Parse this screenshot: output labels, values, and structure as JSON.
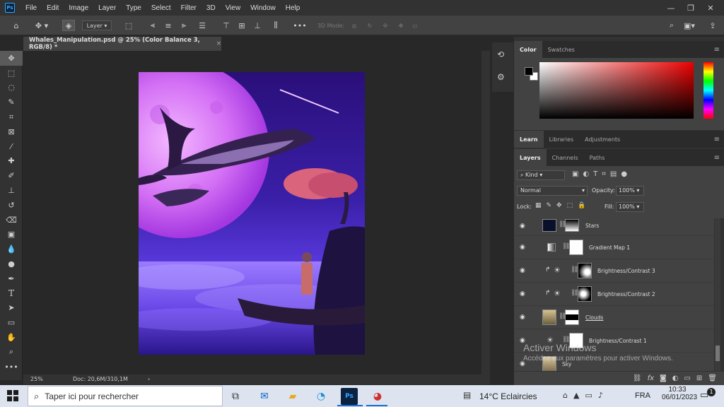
{
  "app": {
    "logo": "Ps"
  },
  "menu": [
    "File",
    "Edit",
    "Image",
    "Layer",
    "Type",
    "Select",
    "Filter",
    "3D",
    "View",
    "Window",
    "Help"
  ],
  "options_bar": {
    "auto_select_target": "Layer",
    "three_d_mode_label": "3D Mode:"
  },
  "document_tab": {
    "title": "Whales_Manipulation.psd @ 25% (Color Balance 3, RGB/8) *",
    "close": "×"
  },
  "status_bar": {
    "zoom": "25%",
    "doc_info": "Doc: 20,6M/310,1M",
    "arrow": "›"
  },
  "color_panel": {
    "tabs": [
      "Color",
      "Swatches"
    ],
    "active": "Color",
    "fg_color": "#000000",
    "bg_color": "#ffffff",
    "picker_hue": "#ff0000"
  },
  "learn_panel": {
    "tabs": [
      "Learn",
      "Libraries",
      "Adjustments"
    ],
    "active": "Learn"
  },
  "layers_panel": {
    "tabs": [
      "Layers",
      "Channels",
      "Paths"
    ],
    "active": "Layers",
    "filter_kind": "Kind",
    "blend_mode": "Normal",
    "opacity_label": "Opacity:",
    "opacity_value": "100%",
    "lock_label": "Lock:",
    "fill_label": "Fill:",
    "fill_value": "100%",
    "layers": [
      {
        "name": "Stars",
        "type": "image-mask"
      },
      {
        "name": "Gradient Map 1",
        "type": "adjustment"
      },
      {
        "name": "Brightness/Contrast 3",
        "type": "clipped-adjustment"
      },
      {
        "name": "Brightness/Contrast 2",
        "type": "clipped-adjustment"
      },
      {
        "name": "Clouds",
        "type": "image-mask"
      },
      {
        "name": "Brightness/Contrast 1",
        "type": "adjustment"
      },
      {
        "name": "Sky",
        "type": "image"
      }
    ]
  },
  "watermark": {
    "title": "Activer Windows",
    "subtitle": "Accédez aux paramètres pour activer Windows."
  },
  "taskbar": {
    "search_placeholder": "Taper ici pour rechercher",
    "weather": "14°C  Eclaircies",
    "language": "FRA",
    "time": "10:33",
    "date": "06/01/2023",
    "notification_count": "1"
  },
  "colors": {
    "accent": "#31a8ff",
    "panel_bg": "#424242",
    "dark_bg": "#282828"
  }
}
